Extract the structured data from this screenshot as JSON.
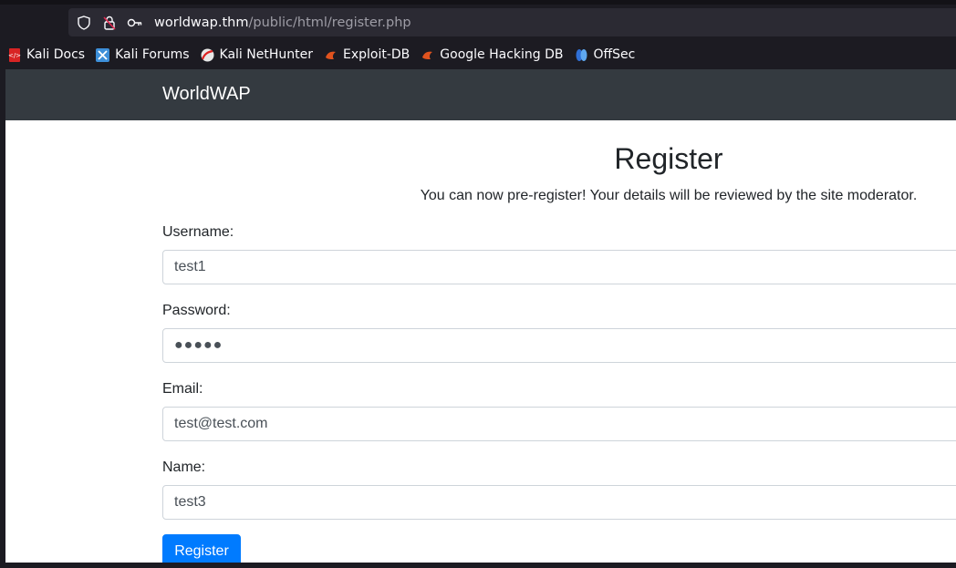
{
  "browser": {
    "url_host": "worldwap.thm",
    "url_path": "/public/html/register.php",
    "bookmarks": [
      {
        "label": "Kali Docs",
        "icon": "kali-docs-icon"
      },
      {
        "label": "Kali Forums",
        "icon": "kali-forums-icon"
      },
      {
        "label": "Kali NetHunter",
        "icon": "kali-nethunter-icon"
      },
      {
        "label": "Exploit-DB",
        "icon": "exploit-db-icon"
      },
      {
        "label": "Google Hacking DB",
        "icon": "google-hacking-db-icon"
      },
      {
        "label": "OffSec",
        "icon": "offsec-icon"
      }
    ]
  },
  "site": {
    "brand": "WorldWAP"
  },
  "page": {
    "title": "Register",
    "subtitle": "You can now pre-register! Your details will be reviewed by the site moderator."
  },
  "form": {
    "username_label": "Username:",
    "username_value": "test1",
    "password_label": "Password:",
    "password_value": "●●●●●",
    "email_label": "Email:",
    "email_value": "test@test.com",
    "name_label": "Name:",
    "name_value": "test3",
    "submit_label": "Register"
  },
  "colors": {
    "navbar": "#343a40",
    "primary_button": "#007bff",
    "browser_chrome": "#1c1b22",
    "urlbar": "#2b2a33"
  }
}
